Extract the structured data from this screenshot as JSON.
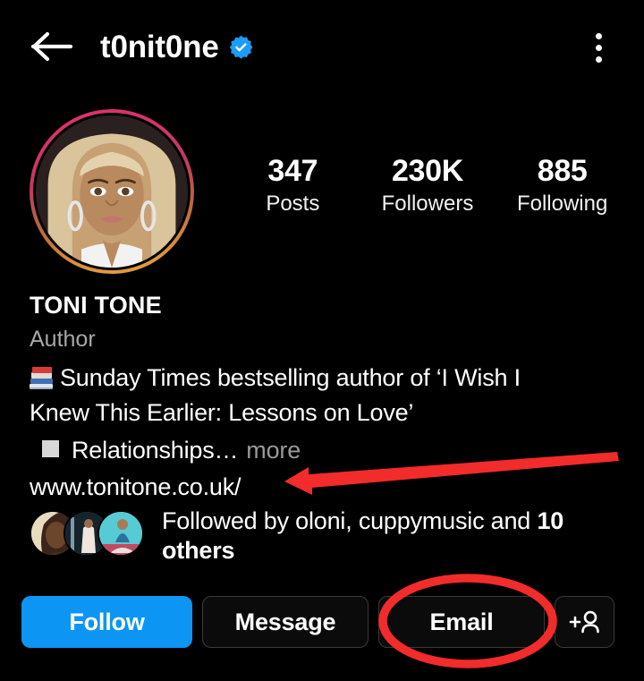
{
  "app": "Instagram profile",
  "header": {
    "back_icon": "back-arrow-icon",
    "username": "t0nit0ne",
    "verified_icon": "verified-badge-icon",
    "menu_icon": "overflow-menu-icon"
  },
  "profile": {
    "avatar_alt": "profile-photo",
    "has_story_ring": true,
    "full_name": "TONI TONE",
    "category": "Author",
    "bio_line_1_emoji": "books-emoji",
    "bio_line_1": "Sunday Times bestselling author of ‘I Wish I",
    "bio_line_2": "Knew This Earlier: Lessons on Love’",
    "bio_line_3_bullet": "white-square-glyph",
    "bio_line_3": "Relationships…",
    "more_label": "more",
    "website": "www.tonitone.co.uk/"
  },
  "stats": [
    {
      "value": "347",
      "label": "Posts"
    },
    {
      "value": "230K",
      "label": "Followers"
    },
    {
      "value": "885",
      "label": "Following"
    }
  ],
  "followed_by": {
    "prefix": "Followed by oloni, cuppymusic and ",
    "count": "10",
    "suffix": " others",
    "avatar_count": 3
  },
  "actions": [
    {
      "label": "Follow",
      "style": "primary"
    },
    {
      "label": "Message",
      "style": "outline"
    },
    {
      "label": "Email",
      "style": "outline",
      "highlighted": true
    },
    {
      "label": "",
      "style": "outline",
      "icon": "add-person-icon"
    }
  ],
  "annotations": {
    "arrow": {
      "shape": "arrow-pointing-left",
      "color": "#f22b2b",
      "target": "website"
    },
    "ellipse": {
      "shape": "ellipse-outline",
      "color": "#f22b2b",
      "target": "Email"
    }
  },
  "colors": {
    "background": "#000000",
    "accent_blue": "#0d95f3",
    "verified_blue": "#1b9cf5",
    "muted_text": "#a8a8a8",
    "annotation_red": "#f22b2b",
    "button_border": "#3a3a3a"
  }
}
